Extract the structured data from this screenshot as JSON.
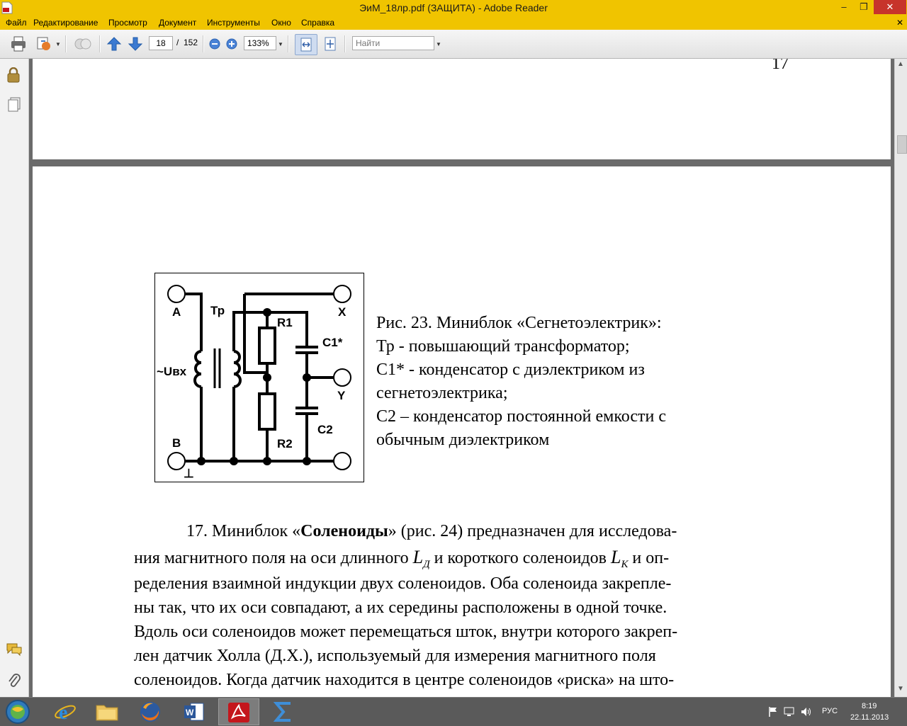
{
  "window": {
    "title": "ЭиМ_18лр.pdf (ЗАЩИТА) - Adobe Reader",
    "controls": {
      "minimize": "–",
      "maximize": "❐",
      "close": "✕"
    }
  },
  "menu": [
    "Файл",
    "Редактирование",
    "Просмотр",
    "Документ",
    "Инструменты",
    "Окно",
    "Справка"
  ],
  "menu_close": "✕",
  "toolbar": {
    "current_page": "18",
    "page_separator": "/",
    "total_pages": "152",
    "zoom": "133%",
    "search_placeholder": "Найти",
    "icons": [
      "printer-icon",
      "scan-icon",
      "network-icon",
      "prev-page-icon",
      "next-page-icon",
      "zoom-out-icon",
      "zoom-in-icon",
      "fit-width-icon",
      "fit-page-icon"
    ]
  },
  "document": {
    "page_number": "17",
    "figure_labels": {
      "A": "A",
      "Tr": "Тр",
      "X": "X",
      "R1": "R1",
      "C1": "C1*",
      "Uin": "~Uвх",
      "Y": "Y",
      "B": "B",
      "R2": "R2",
      "C2": "C2",
      "ground": "⊥"
    },
    "caption": [
      "Рис. 23. Миниблок «Сегнетоэлектрик»:",
      "Тр - повышающий трансформатор;",
      "С1* - конденсатор с диэлектриком из",
      "сегнетоэлектрика;",
      "С2 – конденсатор постоянной емкости с",
      "обычным диэлектриком"
    ],
    "paragraph": {
      "l1_a": "17. Миниблок «",
      "l1_bold": "Соленоиды",
      "l1_b": "» (рис. 24) предназначен для исследова-",
      "l2_a": "ния магнитного поля на оси длинного ",
      "l2_sym1": "L",
      "l2_sub1": "Д",
      "l2_b": " и короткого соленоидов ",
      "l2_sym2": "L",
      "l2_sub2": "К",
      "l2_c": " и оп-",
      "l3": "ределения взаимной индукции двух соленоидов. Оба соленоида закрепле-",
      "l4": "ны так, что их оси совпадают, а их середины расположены в одной точке.",
      "l5": "Вдоль оси соленоидов может перемещаться шток, внутри которого закреп-",
      "l6": "лен датчик Холла (Д.Х.), используемый для измерения магнитного поля",
      "l7": "соленоидов. Когда датчик находится в центре соленоидов «риска» на што-"
    }
  },
  "taskbar": {
    "apps": [
      "start-button",
      "ie-app",
      "explorer-app",
      "firefox-app",
      "word-app",
      "adobe-reader-app",
      "mathcad-app"
    ],
    "language": "РУС",
    "time": "8:19",
    "date": "22.11.2013"
  },
  "colors": {
    "titlebar": "#f0c400",
    "close_button": "#c7342b",
    "taskbar": "#5a5a5a",
    "doc_background": "#6b6b6b"
  }
}
